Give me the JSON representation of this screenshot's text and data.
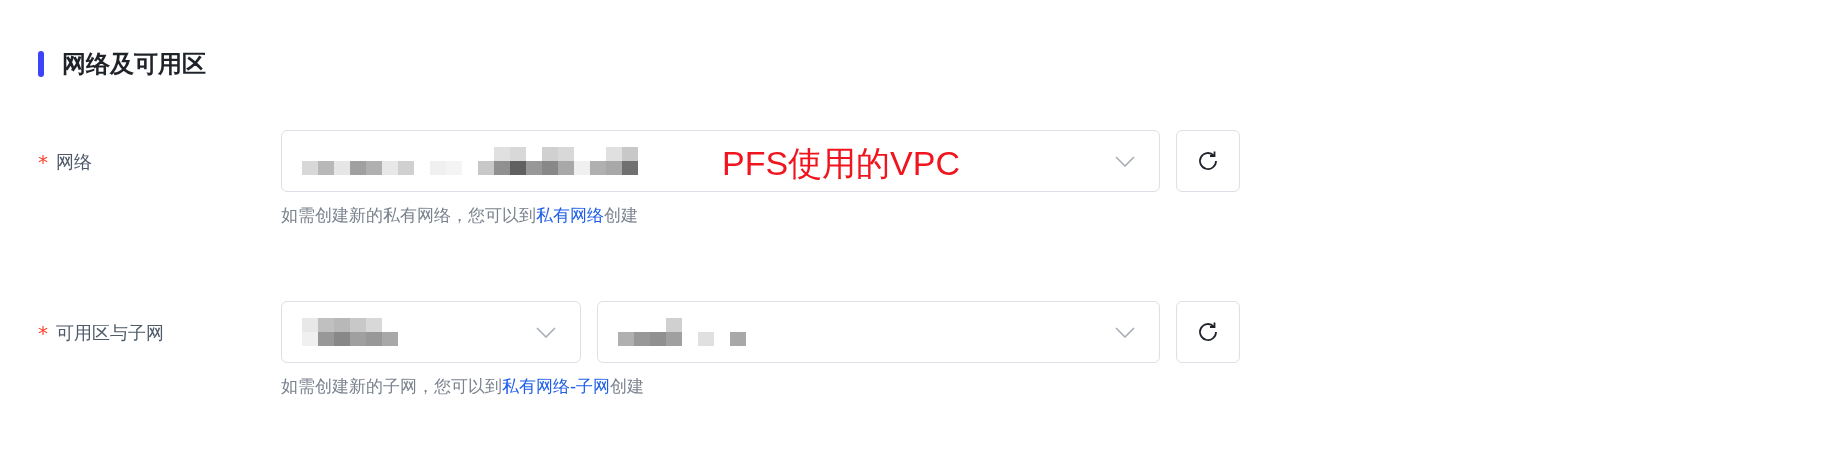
{
  "section": {
    "title": "网络及可用区"
  },
  "rows": [
    {
      "label": "网络",
      "required_mark": "*",
      "kind": "single",
      "annotation": "PFS使用的VPC",
      "help": {
        "before": "如需创建新的私有网络，您可以到",
        "link": "私有网络",
        "after": "创建"
      }
    },
    {
      "label": "可用区与子网",
      "required_mark": "*",
      "kind": "pair",
      "help": {
        "before": "如需创建新的子网，您可以到",
        "link": "私有网络-子网",
        "after": "创建"
      }
    }
  ]
}
